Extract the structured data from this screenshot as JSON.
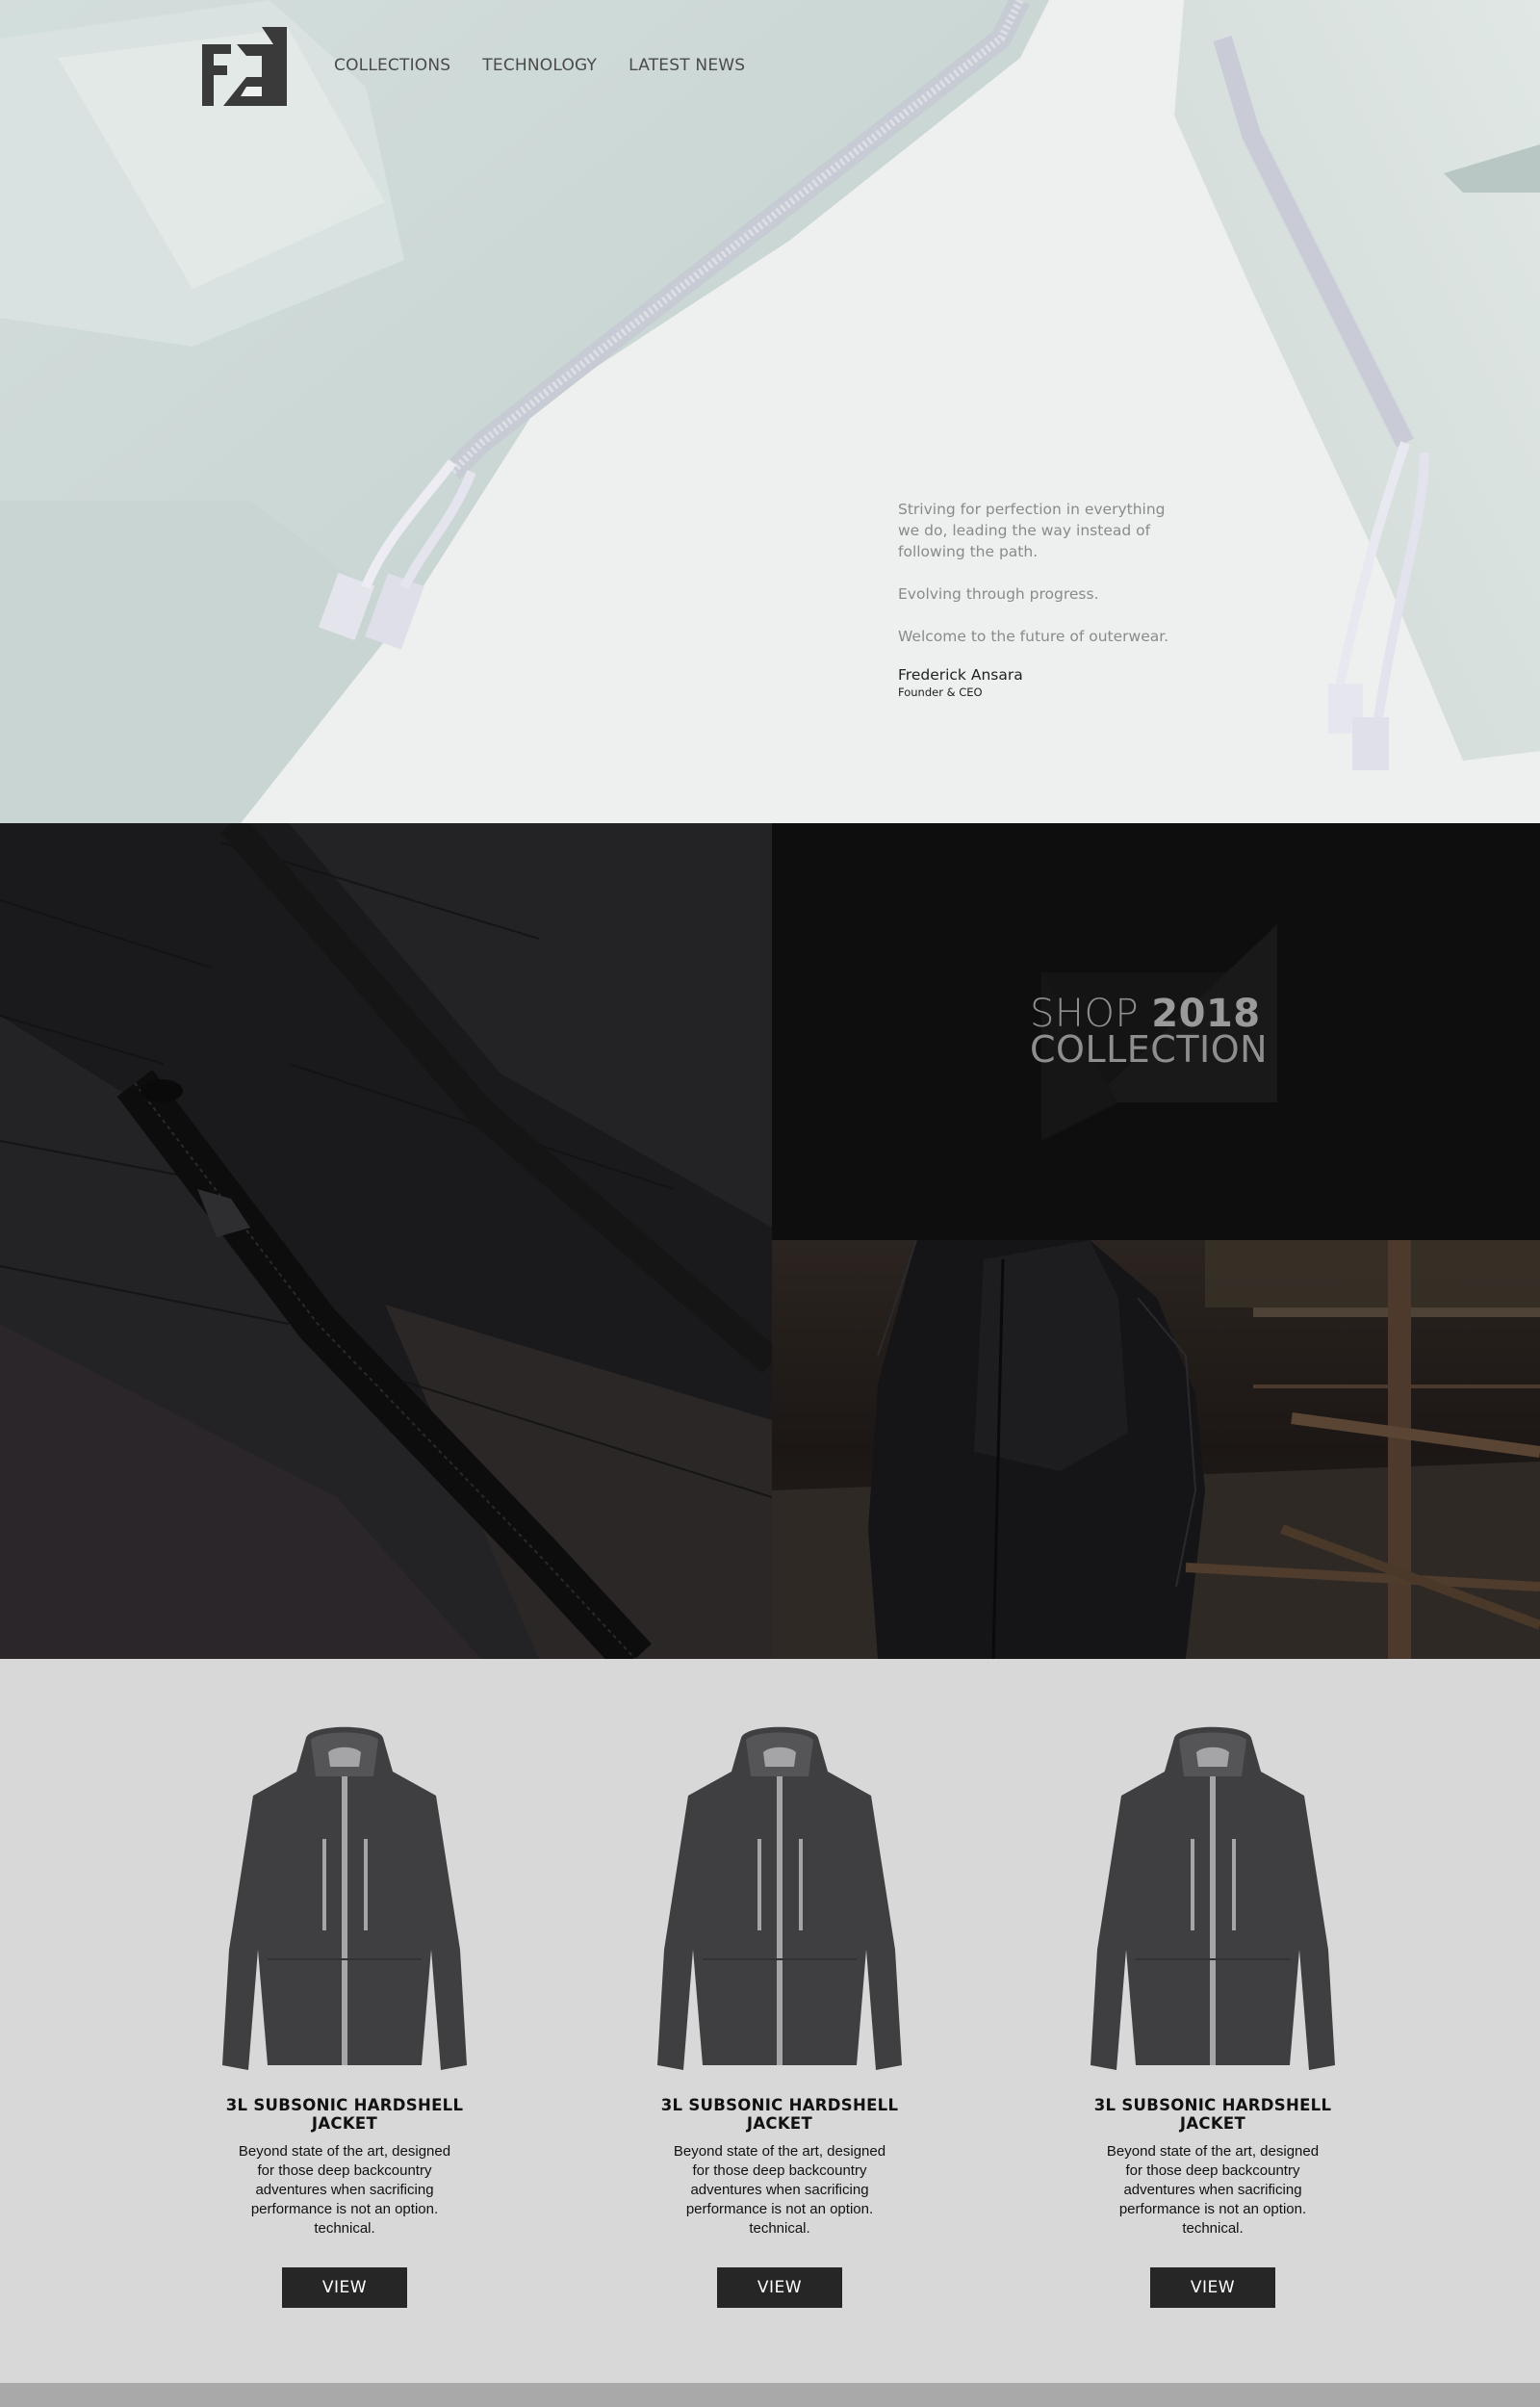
{
  "nav": {
    "items": [
      "COLLECTIONS",
      "TECHNOLOGY",
      "LATEST NEWS"
    ]
  },
  "logo": {
    "icon": "fa-monogram-logo",
    "color": "#3a3a3a"
  },
  "hero": {
    "quote": [
      "Striving for perfection in everything we do, leading the way instead of following the path.",
      "Evolving through progress.",
      "Welcome to the future of outerwear."
    ],
    "author": "Frederick Ansara",
    "author_role": "Founder & CEO"
  },
  "promo": {
    "line1_light": "SHOP ",
    "line1_bold": "2018",
    "line2": "COLLECTION"
  },
  "products": [
    {
      "title": "3L SUBSONIC HARDSHELL JACKET",
      "description": "Beyond state of the art, designed for those deep backcountry adventures when sacrificing performance is not an option. technical.",
      "button": "VIEW"
    },
    {
      "title": "3L SUBSONIC HARDSHELL JACKET",
      "description": "Beyond state of the art, designed for those deep backcountry adventures when sacrificing performance is not an option. technical.",
      "button": "VIEW"
    },
    {
      "title": "3L SUBSONIC HARDSHELL JACKET",
      "description": "Beyond state of the art, designed for those deep backcountry adventures when sacrificing performance is not an option. technical.",
      "button": "VIEW"
    }
  ],
  "colors": {
    "button_bg": "#262626",
    "products_bg": "#d8d8d8",
    "footer_bar": "#a9a9a9"
  }
}
